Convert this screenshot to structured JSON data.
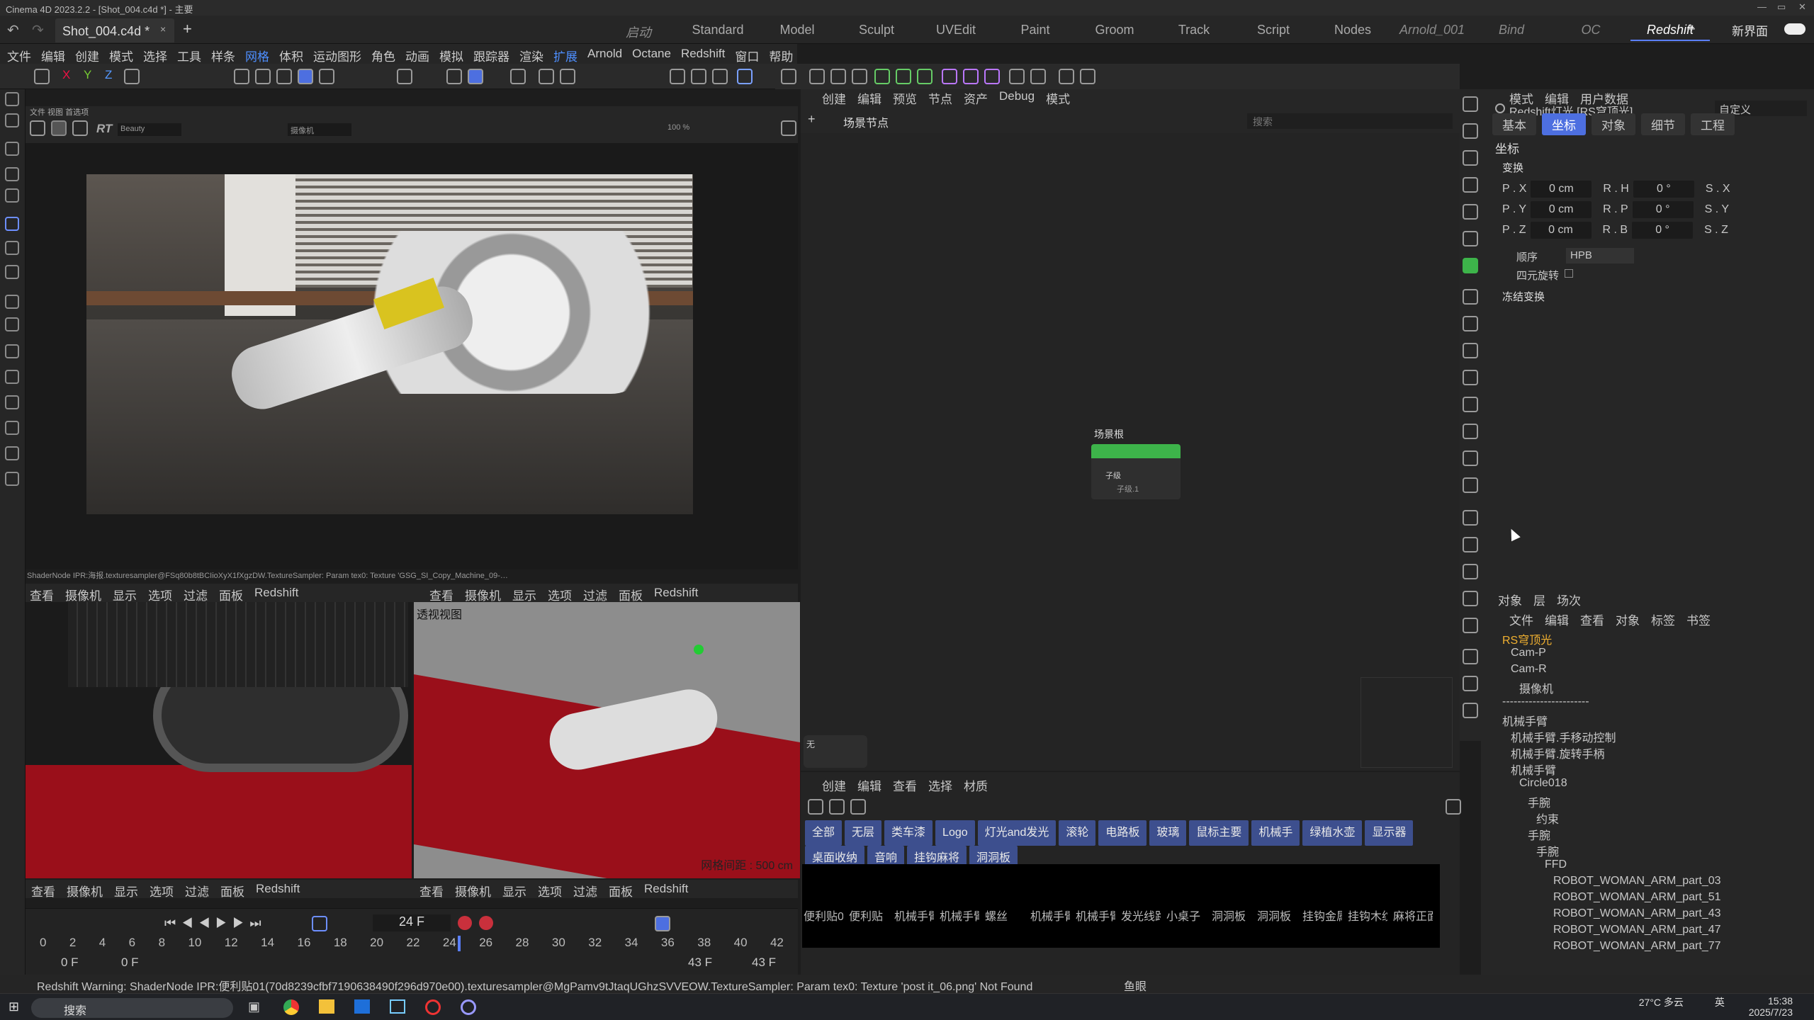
{
  "window": {
    "title": "Cinema 4D 2023.2.2 - [Shot_004.c4d *] - 主要"
  },
  "document_tab": {
    "name": "Shot_004.c4d *",
    "close": "×",
    "add": "+"
  },
  "layouts": [
    {
      "label": "启动",
      "style": "it"
    },
    {
      "label": "Standard",
      "style": ""
    },
    {
      "label": "Model",
      "style": ""
    },
    {
      "label": "Sculpt",
      "style": ""
    },
    {
      "label": "UVEdit",
      "style": ""
    },
    {
      "label": "Paint",
      "style": ""
    },
    {
      "label": "Groom",
      "style": ""
    },
    {
      "label": "Track",
      "style": ""
    },
    {
      "label": "Script",
      "style": ""
    },
    {
      "label": "Nodes",
      "style": ""
    },
    {
      "label": "Arnold_001",
      "style": "it"
    },
    {
      "label": "Bind",
      "style": "it"
    },
    {
      "label": "OC",
      "style": "it"
    },
    {
      "label": "Redshift",
      "style": "on"
    }
  ],
  "new_interface": "新界面",
  "menu": [
    "文件",
    "编辑",
    "创建",
    "模式",
    "选择",
    "工具",
    "样条",
    "网格",
    "体积",
    "运动图形",
    "角色",
    "动画",
    "模拟",
    "跟踪器",
    "渲染",
    "扩展",
    "Arnold",
    "Octane",
    "Redshift",
    "窗口",
    "帮助"
  ],
  "menu_highlight": [
    "网格",
    "扩展"
  ],
  "viewport1": {
    "subtabs": "文件  视图  首选项",
    "rt_label": "RT",
    "beauty": "Beauty",
    "camera": "摄像机",
    "zoom": "100 %"
  },
  "shader_message": "ShaderNode IPR:海报.texturesampler@FSq80b8tBCIioXyX1fXgzDW.TextureSampler: Param tex0: Texture 'GSG_SI_Copy_Machine_09-…",
  "viewport_menu": [
    "查看",
    "摄像机",
    "显示",
    "选项",
    "过滤",
    "面板",
    "Redshift"
  ],
  "viewport3": {
    "label": "透视视图",
    "grid": "网格间距 : 500 cm"
  },
  "timeline": {
    "current_frame": "24 F",
    "ticks": [
      "0",
      "2",
      "4",
      "6",
      "8",
      "10",
      "12",
      "14",
      "16",
      "18",
      "20",
      "22",
      "24",
      "26",
      "28",
      "30",
      "32",
      "34",
      "36",
      "38",
      "40",
      "42"
    ],
    "start": "0 F",
    "start2": "0 F",
    "end": "43 F",
    "end2": "43 F"
  },
  "node_editor": {
    "menu": [
      "创建",
      "编辑",
      "预览",
      "节点",
      "资产",
      "Debug",
      "模式"
    ],
    "breadcrumb": "场景节点",
    "search_placeholder": "搜索",
    "node_title": "场景根",
    "ports": [
      "子级",
      "子级.1"
    ],
    "minimap_label": "无"
  },
  "material_manager": {
    "menu": [
      "创建",
      "编辑",
      "查看",
      "选择",
      "材质"
    ],
    "filters": [
      "全部",
      "无层",
      "类车漆",
      "Logo",
      "灯光and发光",
      "滚轮",
      "电路板",
      "玻璃",
      "鼠标主要",
      "机械手",
      "绿植水壶",
      "显示器",
      "桌面收纳",
      "音响",
      "挂钩麻将",
      "洞洞板"
    ],
    "materials": [
      "便利贴0",
      "便利贴",
      "机械手臂",
      "机械手臂",
      "螺丝",
      "机械手臂",
      "机械手臂",
      "发光线路",
      "小桌子",
      "洞洞板",
      "洞洞板",
      "挂钩金属",
      "挂钩木纹",
      "麻将正面"
    ]
  },
  "attributes": {
    "menu": [
      "模式",
      "编辑",
      "用户数据"
    ],
    "object_title": "Redshift灯光 [RS穹顶光]",
    "preset": "自定义",
    "tabs": [
      "基本",
      "坐标",
      "对象",
      "细节",
      "工程"
    ],
    "active_tab": "坐标",
    "section": "坐标",
    "group": "变换",
    "rows": [
      {
        "p": "P . X",
        "pv": "0 cm",
        "r": "R . H",
        "rv": "0 °",
        "s": "S . X"
      },
      {
        "p": "P . Y",
        "pv": "0 cm",
        "r": "R . P",
        "rv": "0 °",
        "s": "S . Y"
      },
      {
        "p": "P . Z",
        "pv": "0 cm",
        "r": "R . B",
        "rv": "0 °",
        "s": "S . Z"
      }
    ],
    "order_label": "顺序",
    "order_value": "HPB",
    "quat_label": "四元旋转",
    "freeze_label": "冻结变换"
  },
  "object_manager": {
    "tabs": [
      "对象",
      "层",
      "场次"
    ],
    "menu": [
      "文件",
      "编辑",
      "查看",
      "对象",
      "标签",
      "书签"
    ],
    "items": [
      "RS穹顶光",
      "Cam-P",
      "Cam-R",
      "摄像机",
      "-----------------------",
      "机械手臂",
      "机械手臂.手移动控制",
      "机械手臂.旋转手柄",
      "机械手臂",
      "Circle018",
      "手腕",
      "约束",
      "手腕",
      "手腕",
      "FFD",
      "ROBOT_WOMAN_ARM_part_03",
      "ROBOT_WOMAN_ARM_part_51",
      "ROBOT_WOMAN_ARM_part_43",
      "ROBOT_WOMAN_ARM_part_47",
      "ROBOT_WOMAN_ARM_part_77"
    ]
  },
  "status": "Redshift Warning: ShaderNode IPR:便利贴01(70d8239cfbf7190638490f296d970e00).texturesampler@MgPamv9tJtaqUGhzSVVEOW.TextureSampler: Param tex0: Texture 'post it_06.png' Not Found",
  "status_right": "鱼眼",
  "taskbar": {
    "search": "搜索",
    "weather": "27°C 多云",
    "lang": "英",
    "time": "15:38",
    "date": "2025/7/23"
  },
  "colors": {
    "accent": "#4d6fe0",
    "node_green": "#3db44a",
    "highlight_menu": "#4e8fff"
  }
}
